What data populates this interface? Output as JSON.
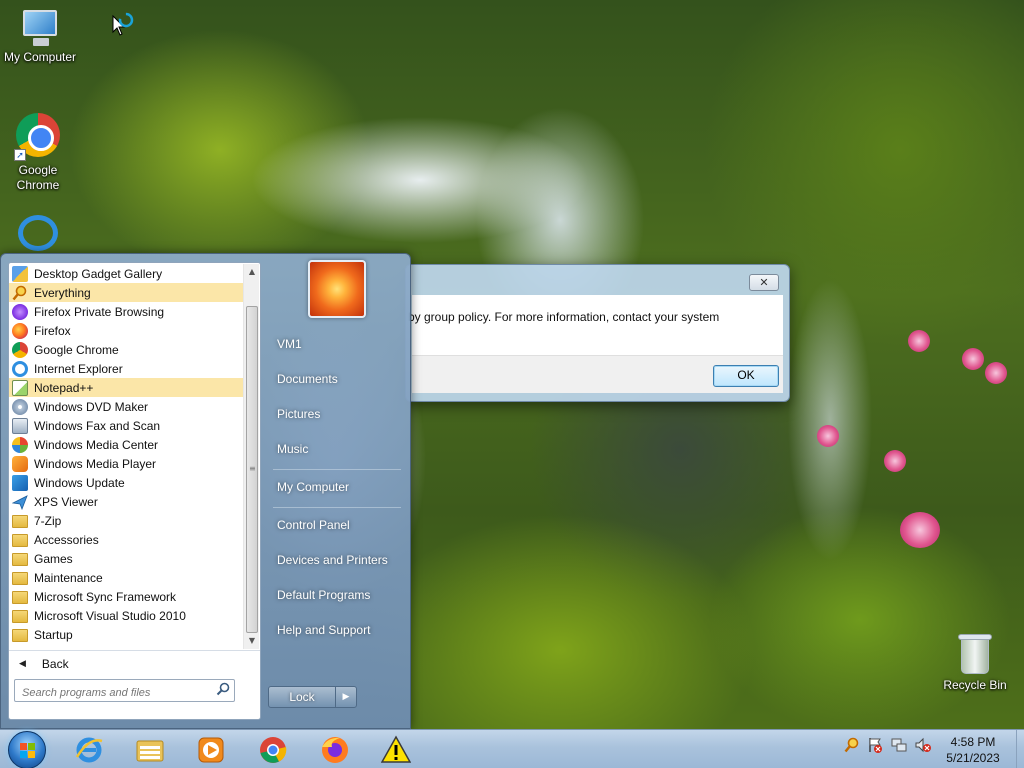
{
  "desktop": {
    "icons": {
      "my_computer": "My Computer",
      "google_chrome": "Google\nChrome",
      "recycle_bin": "Recycle Bin"
    }
  },
  "dialog": {
    "message": "by group policy. For more information, contact your system",
    "close_label": "✕",
    "ok_label": "OK"
  },
  "start_menu": {
    "programs": [
      {
        "label": "Desktop Gadget Gallery",
        "icon": "gadget-icon",
        "highlight": false
      },
      {
        "label": "Everything",
        "icon": "everything-search-icon",
        "highlight": true
      },
      {
        "label": "Firefox Private Browsing",
        "icon": "firefox-private-icon",
        "highlight": false
      },
      {
        "label": "Firefox",
        "icon": "firefox-icon",
        "highlight": false
      },
      {
        "label": "Google Chrome",
        "icon": "chrome-icon",
        "highlight": false
      },
      {
        "label": "Internet Explorer",
        "icon": "internet-explorer-icon",
        "highlight": false
      },
      {
        "label": "Notepad++",
        "icon": "notepad-plus-plus-icon",
        "highlight": true
      },
      {
        "label": "Windows DVD Maker",
        "icon": "dvd-maker-icon",
        "highlight": false
      },
      {
        "label": "Windows Fax and Scan",
        "icon": "fax-scan-icon",
        "highlight": false
      },
      {
        "label": "Windows Media Center",
        "icon": "media-center-icon",
        "highlight": false
      },
      {
        "label": "Windows Media Player",
        "icon": "media-player-icon",
        "highlight": false
      },
      {
        "label": "Windows Update",
        "icon": "windows-update-icon",
        "highlight": false
      },
      {
        "label": "XPS Viewer",
        "icon": "xps-viewer-icon",
        "highlight": false
      },
      {
        "label": "7-Zip",
        "icon": "folder-icon",
        "highlight": false
      },
      {
        "label": "Accessories",
        "icon": "folder-icon",
        "highlight": false
      },
      {
        "label": "Games",
        "icon": "folder-icon",
        "highlight": false
      },
      {
        "label": "Maintenance",
        "icon": "folder-icon",
        "highlight": false
      },
      {
        "label": "Microsoft Sync Framework",
        "icon": "folder-icon",
        "highlight": false
      },
      {
        "label": "Microsoft Visual Studio 2010",
        "icon": "folder-icon",
        "highlight": false
      },
      {
        "label": "Startup",
        "icon": "folder-icon",
        "highlight": false
      }
    ],
    "back_label": "Back",
    "search_placeholder": "Search programs and files",
    "right_items": {
      "user": "VM1",
      "documents": "Documents",
      "pictures": "Pictures",
      "music": "Music",
      "my_computer": "My Computer",
      "control_panel": "Control Panel",
      "devices_printers": "Devices and Printers",
      "default_programs": "Default Programs",
      "help_support": "Help and Support"
    },
    "lock_label": "Lock"
  },
  "taskbar": {
    "pinned": [
      "internet-explorer-icon",
      "file-explorer-icon",
      "media-player-icon",
      "chrome-icon",
      "firefox-icon",
      "warning-icon"
    ],
    "clock_time": "4:58 PM",
    "clock_date": "5/21/2023"
  },
  "colors": {
    "highlight": "#fbe6a8",
    "taskbar": "#a9c2dc",
    "start_menu": "#8caac8"
  }
}
